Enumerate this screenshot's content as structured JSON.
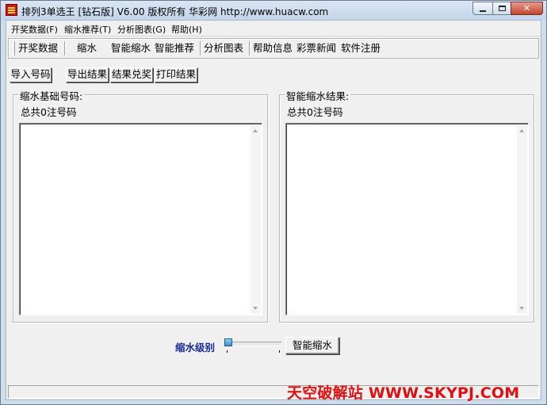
{
  "window": {
    "title": "排列3单选王 [钻石版] V6.00  版权所有 华彩网 http://www.huacw.com"
  },
  "menubar": {
    "items": [
      {
        "label": "开奖数据(F)"
      },
      {
        "label": "缩水推荐(T)"
      },
      {
        "label": "分析图表(G)"
      },
      {
        "label": "帮助(H)"
      }
    ]
  },
  "toolbar": {
    "items": [
      {
        "label": "开奖数据"
      },
      {
        "label": "缩水"
      },
      {
        "label": "智能缩水"
      },
      {
        "label": "智能推荐"
      },
      {
        "label": "分析图表"
      },
      {
        "label": "帮助信息"
      },
      {
        "label": "彩票新闻"
      },
      {
        "label": "软件注册"
      }
    ]
  },
  "actions": {
    "import_label": "导入号码",
    "export_label": "导出结果",
    "redeem_label": "结果兑奖",
    "print_label": "打印结果"
  },
  "base_panel": {
    "caption": "缩水基础号码:",
    "count_text": "总共0注号码"
  },
  "result_panel": {
    "caption": "智能缩水结果:",
    "count_text": "总共0注号码"
  },
  "controls": {
    "level_label": "缩水级别",
    "level_value": 0,
    "smart_reduce_label": "智能缩水"
  },
  "watermark": {
    "text": "天空破解站 WWW.SKYPJ.COM"
  },
  "colors": {
    "level_label": "#1a2a9a",
    "watermark": "#e01010",
    "titlebar": "#cfdcec"
  }
}
